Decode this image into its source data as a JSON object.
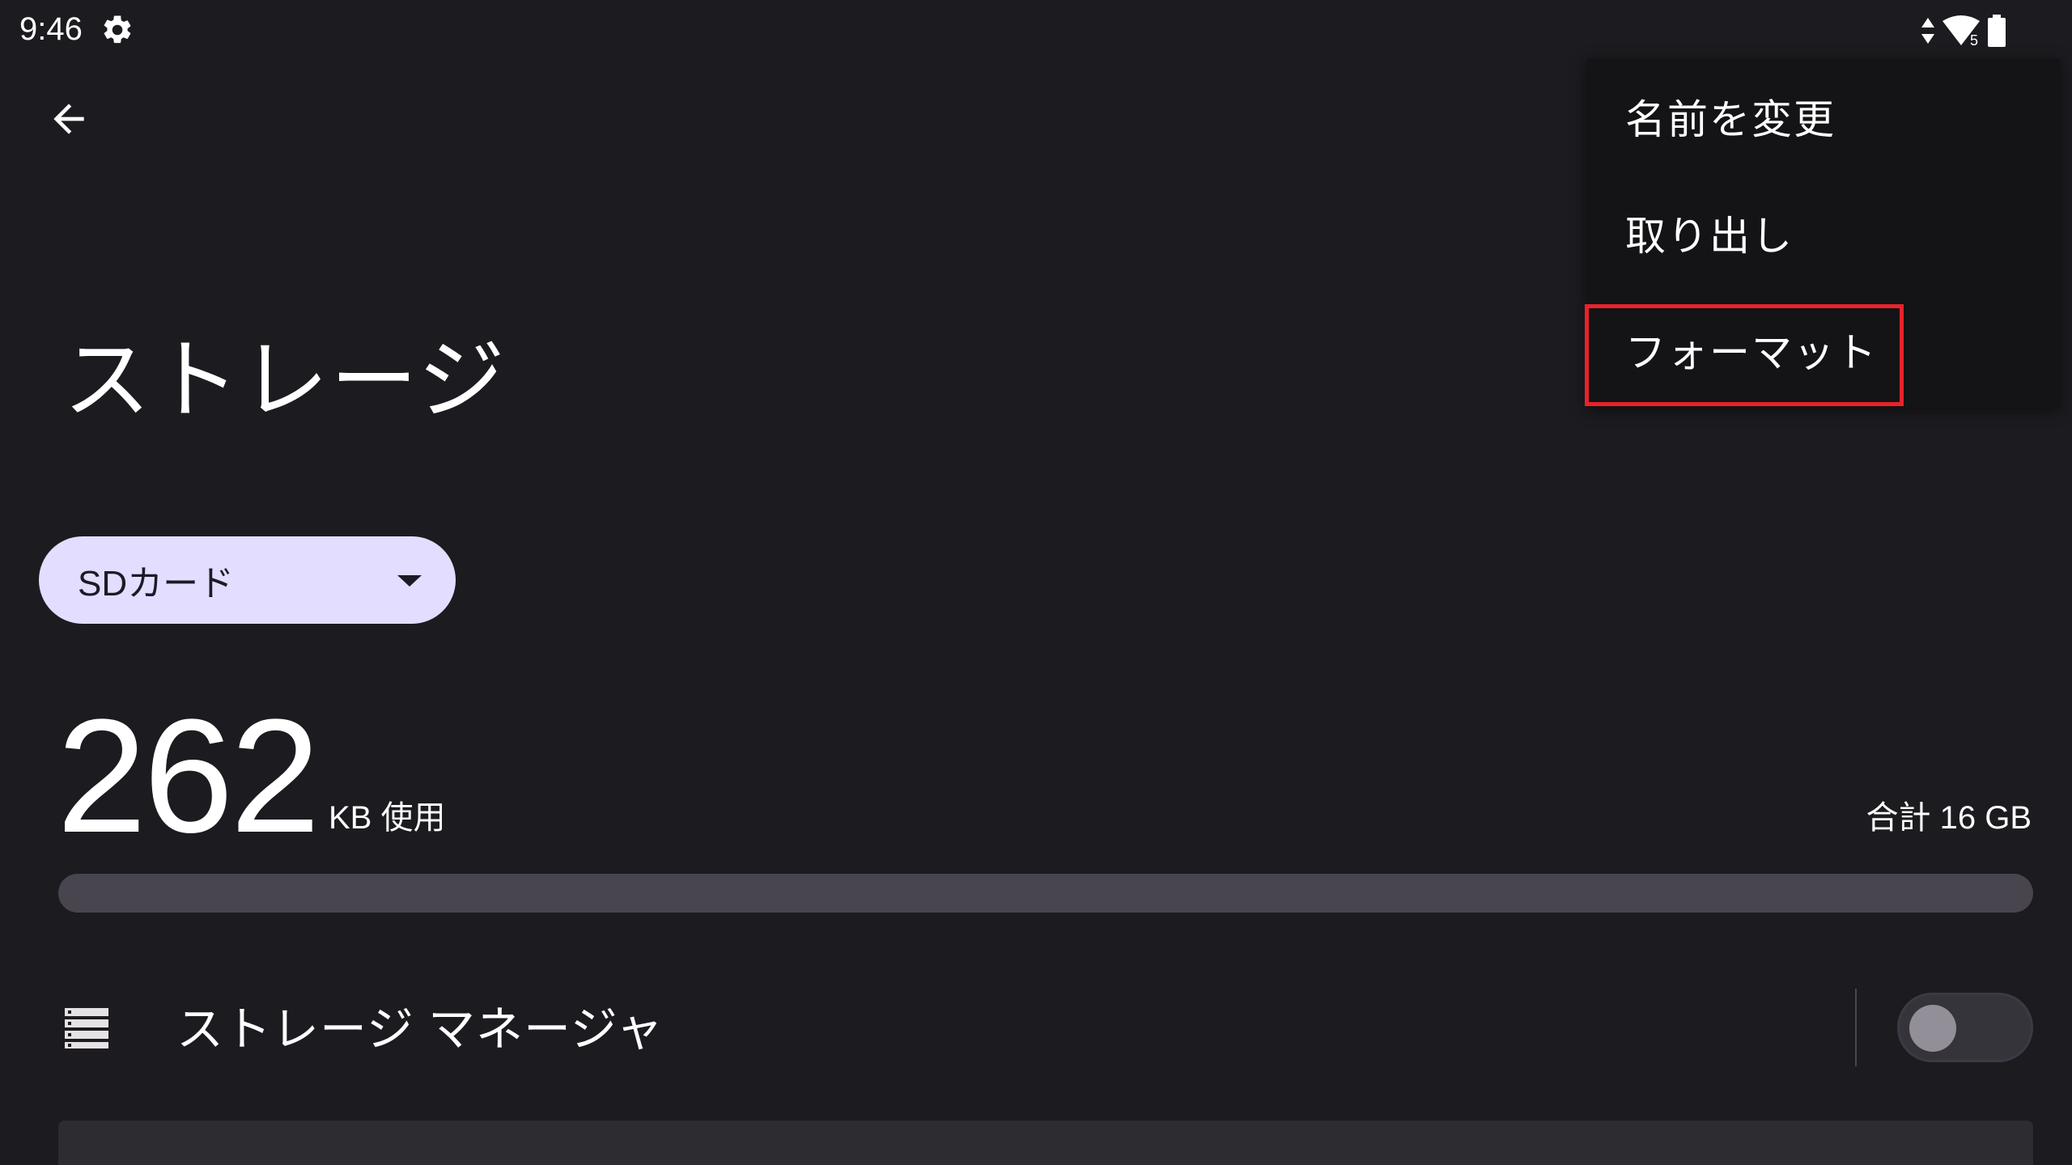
{
  "status_bar": {
    "time": "9:46",
    "settings_icon": "gear-icon",
    "data_icon": "data-updown-icon",
    "wifi_icon": "wifi-icon",
    "wifi_badge": "5",
    "battery_icon": "battery-icon"
  },
  "toolbar": {
    "back_icon": "arrow-back-icon"
  },
  "page": {
    "title": "ストレージ"
  },
  "volume_selector": {
    "selected": "SDカード",
    "icon": "dropdown-triangle-icon"
  },
  "usage": {
    "used_value": "262",
    "used_unit": "KB 使用",
    "total": "合計 16 GB",
    "used_fraction": 0.0
  },
  "storage_manager": {
    "label": "ストレージ マネージャ",
    "icon": "storage-list-icon",
    "enabled": false
  },
  "overflow_menu": {
    "items": [
      {
        "label": "名前を変更"
      },
      {
        "label": "取り出し"
      },
      {
        "label": "フォーマット"
      }
    ],
    "highlighted_index": 2
  },
  "colors": {
    "background": "#1c1b20",
    "dropdown_fill": "#e3ddff",
    "menu_background": "#141316",
    "highlight": "#e8232a",
    "bar_track": "#49454f"
  }
}
